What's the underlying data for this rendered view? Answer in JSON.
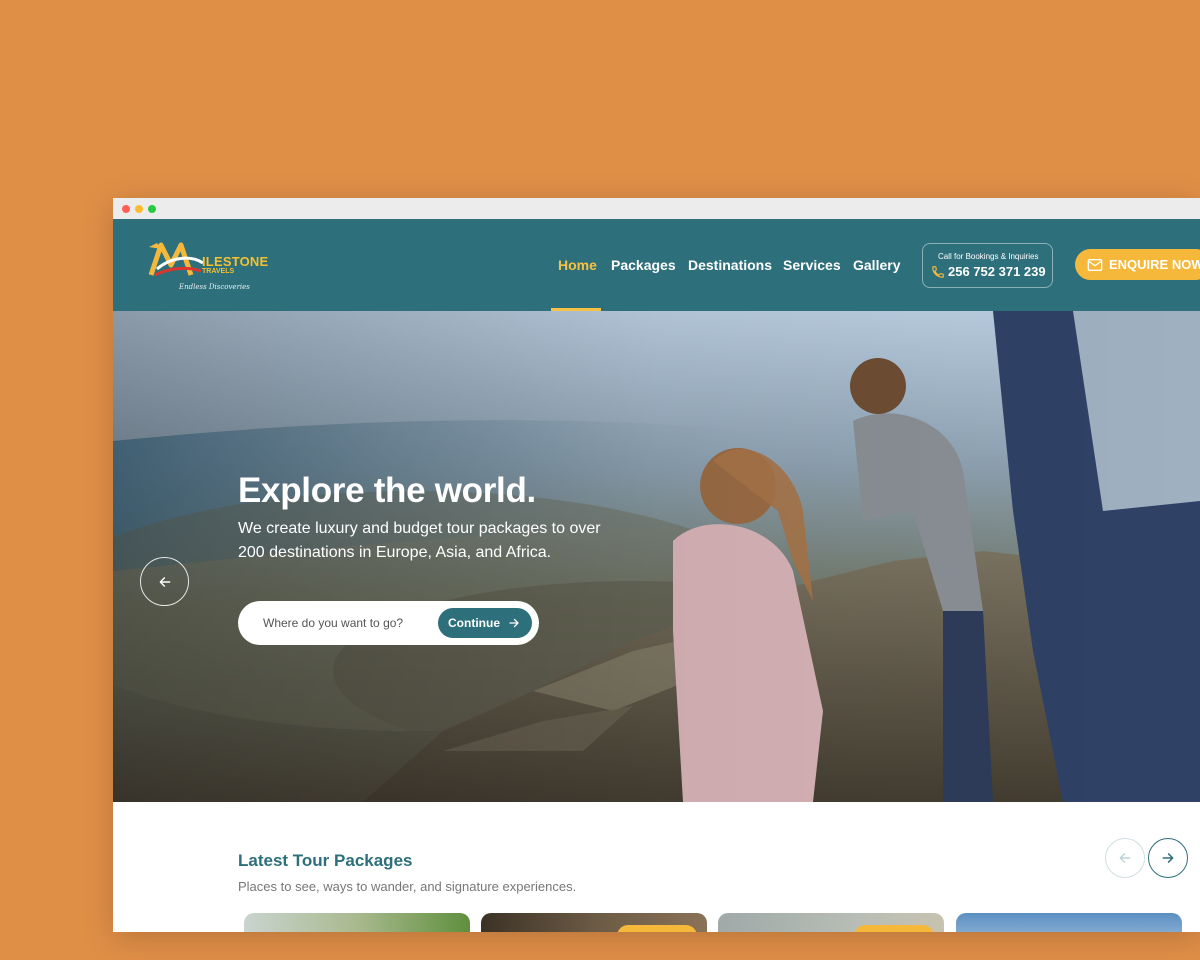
{
  "brand": {
    "name": "ILESTONE",
    "sub": "TRAVELS",
    "tagline": "Endless Discoveries"
  },
  "nav": {
    "items": [
      {
        "label": "Home",
        "active": true
      },
      {
        "label": "Packages",
        "active": false
      },
      {
        "label": "Destinations",
        "active": false
      },
      {
        "label": "Services",
        "active": false
      },
      {
        "label": "Gallery",
        "active": false
      }
    ]
  },
  "call": {
    "caption": "Call for Bookings & Inquiries",
    "number": "256 752 371 239",
    "icon": "phone-icon"
  },
  "enquire": {
    "label": "ENQUIRE NOW",
    "icon": "mail-icon"
  },
  "hero": {
    "title": "Explore the world.",
    "subtitle": "We create luxury and budget tour packages to over 200 destinations in Europe, Asia, and Africa.",
    "search_placeholder": "Where do you want to go?",
    "continue_label": "Continue",
    "prev_icon": "arrow-left-icon"
  },
  "packages": {
    "title": "Latest Tour Packages",
    "subtitle": "Places to see, ways to wander, and signature experiences.",
    "prev_icon": "arrow-left-icon",
    "next_icon": "arrow-right-icon"
  },
  "colors": {
    "page_bg": "#E08F47",
    "header_bg": "#2D6F7B",
    "accent": "#F5B83A",
    "active_nav": "#F7C244"
  }
}
